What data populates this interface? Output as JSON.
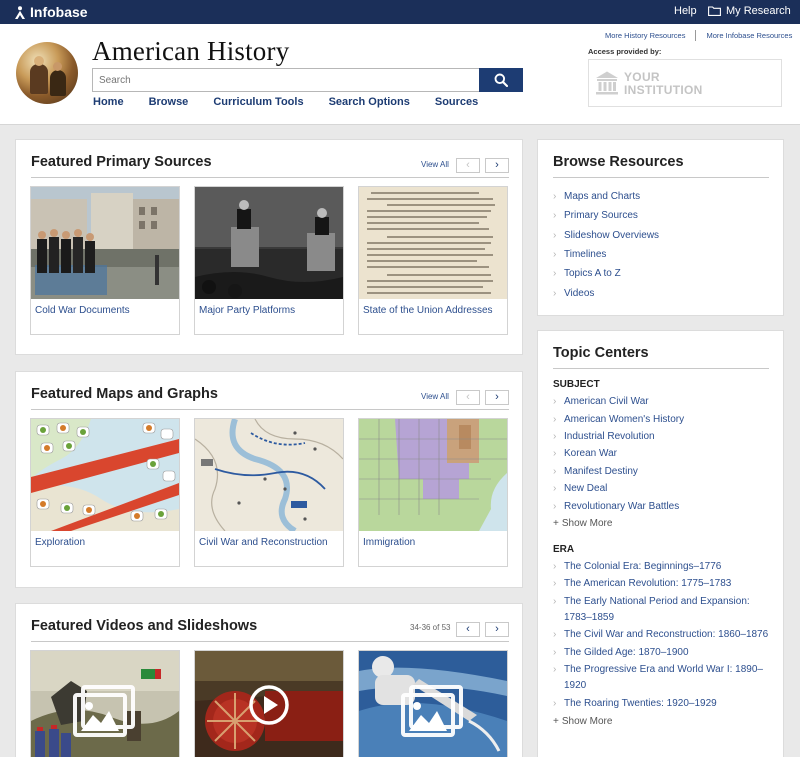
{
  "topbar": {
    "brand": "Infobase",
    "help": "Help",
    "my_research": "My Research"
  },
  "header": {
    "title": "American History",
    "search_placeholder": "Search",
    "nav": [
      "Home",
      "Browse",
      "Curriculum Tools",
      "Search Options",
      "Sources"
    ],
    "ext_links": [
      "More History Resources",
      "More Infobase Resources"
    ],
    "access_label": "Access provided by:",
    "institution_line1": "YOUR",
    "institution_line2": "INSTITUTION"
  },
  "primary_sources": {
    "title": "Featured Primary Sources",
    "view_all": "View All",
    "cards": [
      "Cold War Documents",
      "Major Party Platforms",
      "State of the Union Addresses"
    ]
  },
  "maps_graphs": {
    "title": "Featured Maps and Graphs",
    "view_all": "View All",
    "cards": [
      "Exploration",
      "Civil War and Reconstruction",
      "Immigration"
    ]
  },
  "videos": {
    "title": "Featured Videos and Slideshows",
    "pager": "34-36 of 53"
  },
  "browse": {
    "title": "Browse Resources",
    "items": [
      "Maps and Charts",
      "Primary Sources",
      "Slideshow Overviews",
      "Timelines",
      "Topics A to Z",
      "Videos"
    ]
  },
  "topics": {
    "title": "Topic Centers",
    "subject_heading": "SUBJECT",
    "subject_items": [
      "American Civil War",
      "American Women's History",
      "Industrial Revolution",
      "Korean War",
      "Manifest Destiny",
      "New Deal",
      "Revolutionary War Battles"
    ],
    "show_more": "Show More",
    "era_heading": "ERA",
    "era_items": [
      [
        "The Colonial Era: Beginnings–1776"
      ],
      [
        "The American Revolution: 1775–1783"
      ],
      [
        "The Early National Period and Expansion:",
        "1783–1859"
      ],
      [
        "The Civil War and Reconstruction: 1860–1876"
      ],
      [
        "The Gilded Age: 1870–1900"
      ],
      [
        "The Progressive Era and World War I: 1890–",
        "1920"
      ],
      [
        "The Roaring Twenties: 1920–1929"
      ]
    ],
    "show_more_era": "Show More"
  },
  "colors": {
    "topbar": "#1b2f59",
    "accent": "#1d3c73",
    "link": "#2d4f8e"
  }
}
